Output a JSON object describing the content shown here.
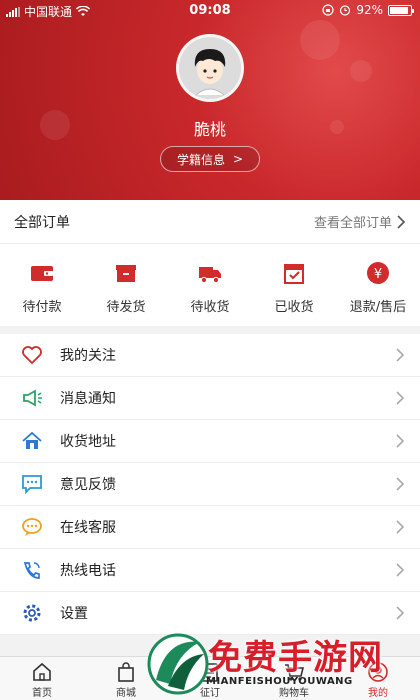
{
  "statusbar": {
    "carrier": "中国联通",
    "time": "09:08",
    "battery": "92%",
    "battery_level": 0.92
  },
  "profile": {
    "name": "脆桃",
    "info_button": "学籍信息",
    "info_arrow": ">"
  },
  "orders": {
    "title": "全部订单",
    "view_all": "查看全部订单",
    "items": [
      {
        "label": "待付款",
        "icon": "wallet-icon"
      },
      {
        "label": "待发货",
        "icon": "box-icon"
      },
      {
        "label": "待收货",
        "icon": "truck-icon"
      },
      {
        "label": "已收货",
        "icon": "received-box-icon"
      },
      {
        "label": "退款/售后",
        "icon": "yuan-icon"
      }
    ]
  },
  "menu": {
    "items": [
      {
        "label": "我的关注",
        "icon": "heart-icon"
      },
      {
        "label": "消息通知",
        "icon": "megaphone-icon"
      },
      {
        "label": "收货地址",
        "icon": "home-icon"
      },
      {
        "label": "意见反馈",
        "icon": "chat-icon"
      },
      {
        "label": "在线客服",
        "icon": "service-chat-icon"
      },
      {
        "label": "热线电话",
        "icon": "phone-icon"
      },
      {
        "label": "设置",
        "icon": "settings-icon"
      }
    ]
  },
  "nav": {
    "items": [
      {
        "label": "首页",
        "icon": "home-icon"
      },
      {
        "label": "商城",
        "icon": "bag-icon"
      },
      {
        "label": "征订",
        "icon": "order-icon"
      },
      {
        "label": "购物车",
        "icon": "cart-icon"
      },
      {
        "label": "我的",
        "icon": "user-icon",
        "active": true
      }
    ]
  },
  "watermark": {
    "title": "免费手游网",
    "subtitle": "MIANFEISHOUYOUWANG"
  },
  "colors": {
    "accent": "#d12b2b",
    "header": "#c9282b"
  }
}
